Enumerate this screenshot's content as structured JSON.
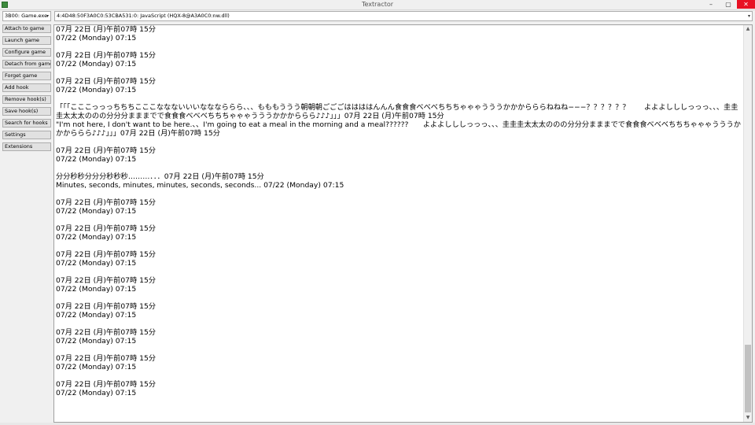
{
  "window": {
    "title": "Textractor",
    "minimize_glyph": "–",
    "maximize_glyph": "▢",
    "close_glyph": "✕"
  },
  "process_select": {
    "value": "3B00: Game.exe",
    "arrow": "▾"
  },
  "hook_select": {
    "value": "4:4D48:50F3A0C0:53CBA531:0: JavaScript (HQX-8@A3A0C0:nw.dll)",
    "arrow": "▾"
  },
  "buttons": [
    "Attach to game",
    "Launch game",
    "Configure game",
    "Detach from game",
    "Forget game",
    "Add hook",
    "Remove hook(s)",
    "Save hook(s)",
    "Search for hooks",
    "Settings",
    "Extensions"
  ],
  "text_lines": [
    "07月 22日 (月)午前07時 15分",
    "07/22 (Monday) 07:15",
    "",
    "07月 22日 (月)午前07時 15分",
    "07/22 (Monday) 07:15",
    "",
    "07月 22日 (月)午前07時 15分",
    "07/22 (Monday) 07:15",
    "",
    "「「「こここっっっちちちこここななないいいなななららら、、、もももううう朝朝朝ごごごははははんんん食食食べべべちちちゃゃゃうううかかからららねねね−−−？？？？？？　　よよよしししっっっ、、、圭圭圭太太太ののの分分分まままでで食食食べべべちちちゃゃゃうううかかかららら♪♪♪」」」07月 22日 (月)午前07時 15分",
    "\"I'm not here, I don't want to be here.、、I'm going to eat a meal in the morning and a meal??????　　よよよしししっっっ、、、圭圭圭太太太ののの分分分まままでで食食食べべべちちちゃゃゃうううかかかららら♪♪♪」」」07月 22日 (月)午前07時 15分",
    "",
    "07月 22日 (月)午前07時 15分",
    "07/22 (Monday) 07:15",
    "",
    "分分秒秒分分分秒秒秒………．．．07月 22日 (月)午前07時 15分",
    "Minutes, seconds, minutes, minutes, seconds, seconds... 07/22 (Monday) 07:15",
    "",
    "07月 22日 (月)午前07時 15分",
    "07/22 (Monday) 07:15",
    "",
    "07月 22日 (月)午前07時 15分",
    "07/22 (Monday) 07:15",
    "",
    "07月 22日 (月)午前07時 15分",
    "07/22 (Monday) 07:15",
    "",
    "07月 22日 (月)午前07時 15分",
    "07/22 (Monday) 07:15",
    "",
    "07月 22日 (月)午前07時 15分",
    "07/22 (Monday) 07:15",
    "",
    "07月 22日 (月)午前07時 15分",
    "07/22 (Monday) 07:15",
    "",
    "07月 22日 (月)午前07時 15分",
    "07/22 (Monday) 07:15",
    "",
    "07月 22日 (月)午前07時 15分",
    "07/22 (Monday) 07:15"
  ],
  "scrollbar": {
    "up_glyph": "▲",
    "down_glyph": "▼"
  }
}
